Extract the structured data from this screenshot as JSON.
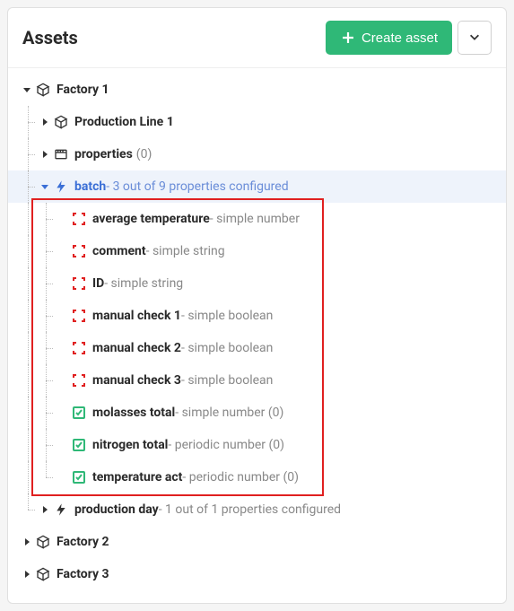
{
  "header": {
    "title": "Assets",
    "create_label": "Create asset"
  },
  "tree": {
    "factory1": {
      "label": "Factory 1",
      "prod_line1": {
        "label": "Production Line 1"
      },
      "properties": {
        "label": "properties",
        "meta_count": "(0)"
      },
      "batch": {
        "label": "batch",
        "meta": "3 out of 9 properties configured",
        "items": [
          {
            "label": "average temperature",
            "meta": "simple number",
            "status": "unconfigured"
          },
          {
            "label": "comment",
            "meta": "simple string",
            "status": "unconfigured"
          },
          {
            "label": "ID",
            "meta": "simple string",
            "status": "unconfigured"
          },
          {
            "label": "manual check 1",
            "meta": "simple boolean",
            "status": "unconfigured"
          },
          {
            "label": "manual check 2",
            "meta": "simple boolean",
            "status": "unconfigured"
          },
          {
            "label": "manual check 3",
            "meta": "simple boolean",
            "status": "unconfigured"
          },
          {
            "label": "molasses total",
            "meta": "simple number (0)",
            "status": "configured"
          },
          {
            "label": "nitrogen total",
            "meta": "periodic number (0)",
            "status": "configured"
          },
          {
            "label": "temperature act",
            "meta": "periodic number (0)",
            "status": "configured"
          }
        ]
      },
      "production_day": {
        "label": "production day",
        "meta": "1 out of 1 properties configured"
      }
    },
    "factory2": {
      "label": "Factory 2"
    },
    "factory3": {
      "label": "Factory 3"
    }
  }
}
